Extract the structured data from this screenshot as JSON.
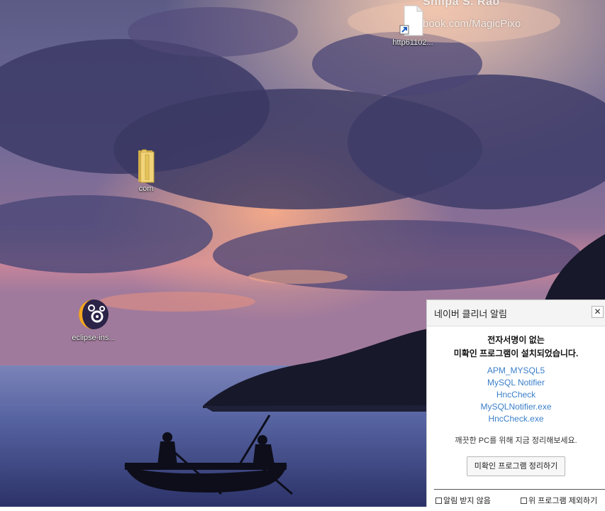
{
  "wallpaper": {
    "watermark_name": "Shilpa S. Rao",
    "watermark_url": "book.com/MagicPixo"
  },
  "desktop": {
    "icons": [
      {
        "label": "http61102...",
        "icon": "shortcut-file-icon"
      },
      {
        "label": "com",
        "icon": "folder-icon"
      },
      {
        "label": "eclipse-ins...",
        "icon": "eclipse-installer-icon"
      }
    ]
  },
  "popup": {
    "title": "네이버 클리너 알림",
    "close_glyph": "✕",
    "headline_line1": "전자서명이 없는",
    "headline_line2": "미확인 프로그램이 설치되었습니다.",
    "programs": [
      "APM_MYSQL5",
      "MySQL Notifier",
      "HncCheck",
      "MySQLNotifier.exe",
      "HncCheck.exe"
    ],
    "hint": "깨끗한 PC를 위해 지금 정리해보세요.",
    "cleanup_button": "미확인 프로그램 정리하기",
    "options": {
      "no_alert": "알림 받지 않음",
      "exclude_programs": "위 프로그램 제외하기"
    },
    "colors": {
      "link": "#3a7fc9",
      "header_bg": "#f4f4f4"
    }
  }
}
